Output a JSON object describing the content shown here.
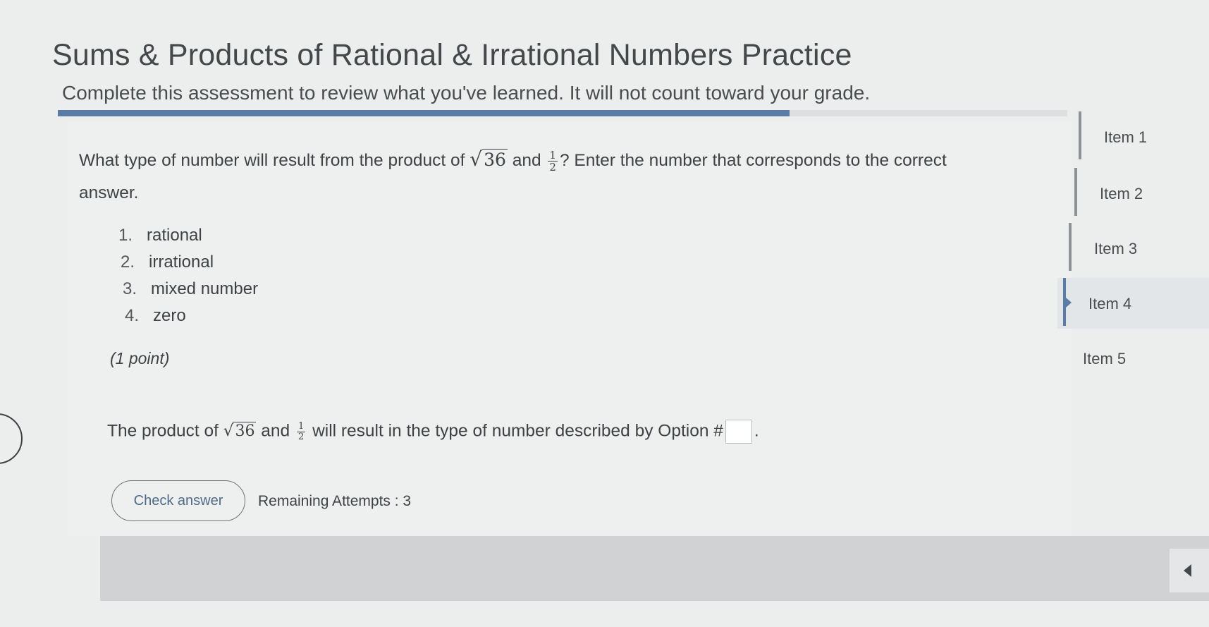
{
  "header": {
    "title": "Sums & Products of Rational & Irrational Numbers Practice",
    "subtitle": "Complete this assessment to review what you've learned. It will not count toward your grade.",
    "progress_fraction": 0.725
  },
  "question": {
    "prompt_start": "What type of number will result from the product of",
    "sqrt_radicand": "36",
    "and_word": "and",
    "fraction_numerator": "1",
    "fraction_denominator": "2",
    "prompt_end": "? Enter the number that corresponds to the correct answer.",
    "options": [
      {
        "number": "1.",
        "label": "rational"
      },
      {
        "number": "2.",
        "label": "irrational"
      },
      {
        "number": "3.",
        "label": "mixed number"
      },
      {
        "number": "4.",
        "label": "zero"
      }
    ],
    "points": "(1 point)"
  },
  "answer": {
    "sentence_start": "The product of",
    "sqrt_radicand": "36",
    "and_word": "and",
    "fraction_numerator": "1",
    "fraction_denominator": "2",
    "sentence_mid": "will result in the type of number described by Option #",
    "sentence_end": ".",
    "input_value": ""
  },
  "actions": {
    "check_label": "Check answer",
    "attempts_text": "Remaining Attempts : 3"
  },
  "item_nav": {
    "items": [
      "Item 1",
      "Item 2",
      "Item 3",
      "Item 4",
      "Item 5"
    ],
    "active_index": 3
  },
  "colors": {
    "accent": "#5a7ba4",
    "background": "#eceeed"
  },
  "icons": {
    "collapse": "triangle-left-icon",
    "previous": "previous-circle-icon"
  }
}
